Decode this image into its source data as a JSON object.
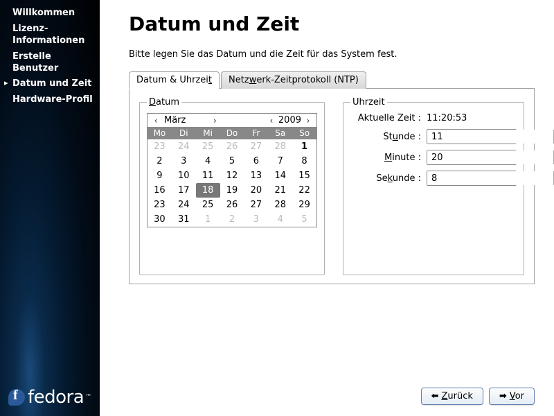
{
  "sidebar": {
    "items": [
      {
        "label": "Willkommen"
      },
      {
        "label": "Lizenz-Informationen"
      },
      {
        "label": "Erstelle Benutzer"
      },
      {
        "label": "Datum und Zeit"
      },
      {
        "label": "Hardware-Profil"
      }
    ],
    "active_index": 3,
    "logo_text": "fedora",
    "logo_tm": "™"
  },
  "header": {
    "title": "Datum und Zeit",
    "intro": "Bitte legen Sie das Datum und die Zeit für das System fest."
  },
  "tabs": {
    "active_index": 0,
    "items": [
      {
        "label_pre": "Datum & Uhrzei",
        "label_mn": "t",
        "label_post": ""
      },
      {
        "label_pre": "Netz",
        "label_mn": "w",
        "label_post": "erk-Zeitprotokoll (NTP)"
      }
    ]
  },
  "date_group": {
    "legend_pre": "",
    "legend_mn": "D",
    "legend_post": "atum",
    "month": "März",
    "year": "2009",
    "dow": [
      "Mo",
      "Di",
      "Mi",
      "Do",
      "Fr",
      "Sa",
      "So"
    ],
    "weeks": [
      [
        {
          "n": "23",
          "o": true
        },
        {
          "n": "24",
          "o": true
        },
        {
          "n": "25",
          "o": true
        },
        {
          "n": "26",
          "o": true
        },
        {
          "n": "27",
          "o": true
        },
        {
          "n": "28",
          "o": true
        },
        {
          "n": "1",
          "b": true
        }
      ],
      [
        {
          "n": "2"
        },
        {
          "n": "3"
        },
        {
          "n": "4"
        },
        {
          "n": "5"
        },
        {
          "n": "6"
        },
        {
          "n": "7"
        },
        {
          "n": "8"
        }
      ],
      [
        {
          "n": "9"
        },
        {
          "n": "10"
        },
        {
          "n": "11"
        },
        {
          "n": "12"
        },
        {
          "n": "13"
        },
        {
          "n": "14"
        },
        {
          "n": "15"
        }
      ],
      [
        {
          "n": "16"
        },
        {
          "n": "17"
        },
        {
          "n": "18",
          "sel": true
        },
        {
          "n": "19"
        },
        {
          "n": "20"
        },
        {
          "n": "21"
        },
        {
          "n": "22"
        }
      ],
      [
        {
          "n": "23"
        },
        {
          "n": "24"
        },
        {
          "n": "25"
        },
        {
          "n": "26"
        },
        {
          "n": "27"
        },
        {
          "n": "28"
        },
        {
          "n": "29"
        }
      ],
      [
        {
          "n": "30"
        },
        {
          "n": "31"
        },
        {
          "n": "1",
          "o": true
        },
        {
          "n": "2",
          "o": true
        },
        {
          "n": "3",
          "o": true
        },
        {
          "n": "4",
          "o": true
        },
        {
          "n": "5",
          "o": true
        }
      ]
    ]
  },
  "time_group": {
    "legend": "Uhrzeit",
    "current_label": "Aktuelle Zeit :",
    "current_value": "11:20:53",
    "hour": {
      "label_pre": "St",
      "label_mn": "u",
      "label_post": "nde :",
      "value": "11"
    },
    "minute": {
      "label_pre": "",
      "label_mn": "M",
      "label_post": "inute :",
      "value": "20"
    },
    "second": {
      "label_pre": "Se",
      "label_mn": "k",
      "label_post": "unde :",
      "value": "8"
    }
  },
  "footer": {
    "back": {
      "mn": "Z",
      "post": "urück"
    },
    "forward": {
      "mn": "V",
      "post": "or"
    }
  }
}
